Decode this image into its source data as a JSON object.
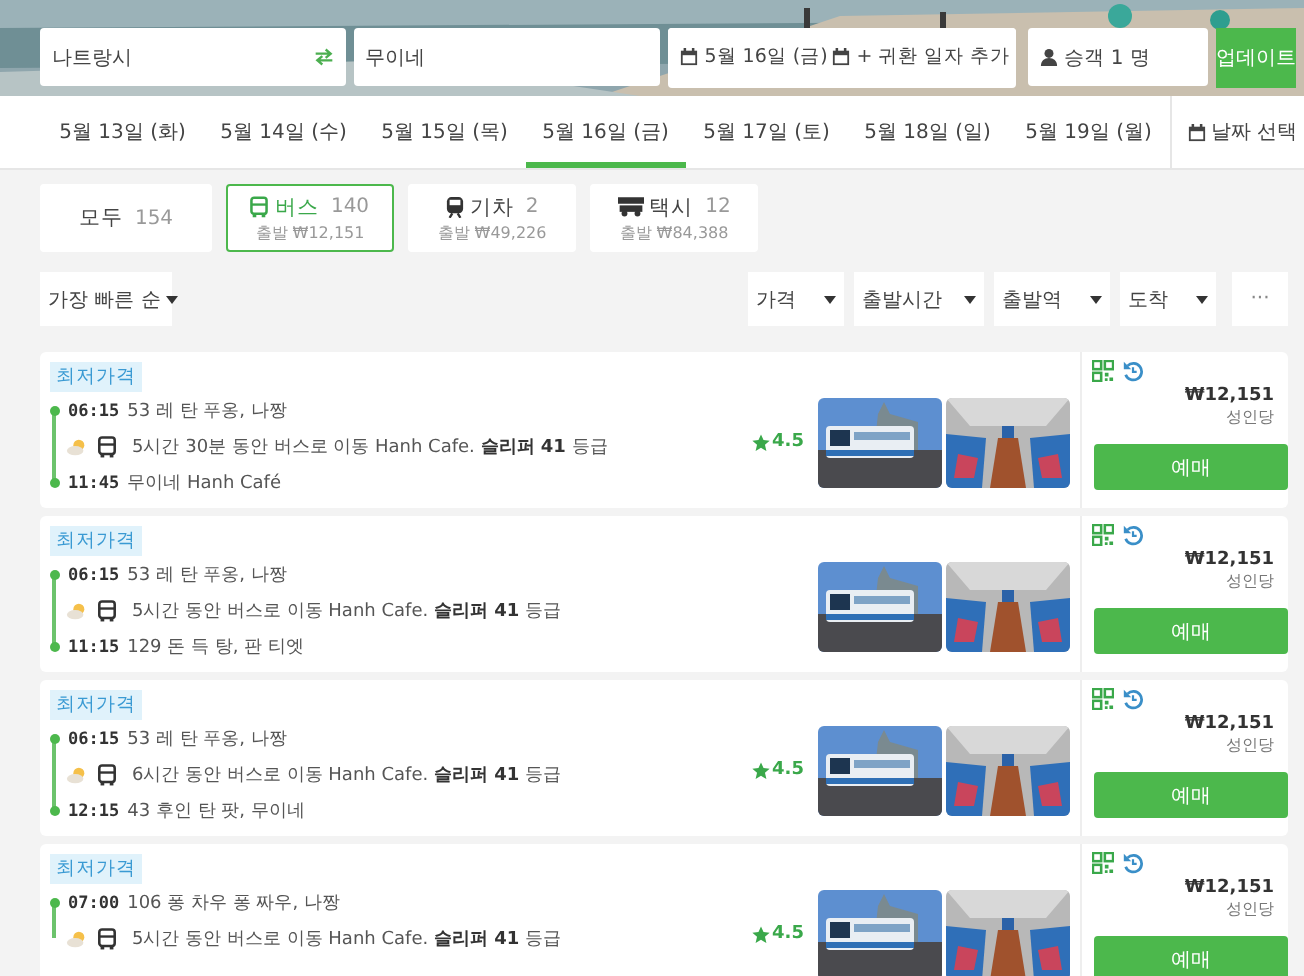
{
  "search": {
    "origin": "나트랑시",
    "destination": "무이네",
    "date": "5월 16일 (금)",
    "return_date": "+ 귀환 일자 추가",
    "passengers": "승객 1 명",
    "submit": "업데이트"
  },
  "date_tabs": [
    {
      "label": "5월 13일 (화)",
      "selected": false
    },
    {
      "label": "5월 14일 (수)",
      "selected": false
    },
    {
      "label": "5월 15일 (목)",
      "selected": false
    },
    {
      "label": "5월 16일 (금)",
      "selected": true
    },
    {
      "label": "5월 17일 (토)",
      "selected": false
    },
    {
      "label": "5월 18일 (일)",
      "selected": false
    },
    {
      "label": "5월 19일 (월)",
      "selected": false
    }
  ],
  "date_picker": "날짜 선택",
  "modes": [
    {
      "kind": "all",
      "label": "모두",
      "count": "154",
      "selected": false
    },
    {
      "kind": "bus",
      "label": "버스",
      "count": "140",
      "price": "출발 ₩12,151",
      "selected": true
    },
    {
      "kind": "train",
      "label": "기차",
      "count": "2",
      "price": "출발 ₩49,226",
      "selected": false
    },
    {
      "kind": "taxi",
      "label": "택시",
      "count": "12",
      "price": "출발 ₩84,388",
      "selected": false
    }
  ],
  "sort": "가장 빠른 순",
  "filters": [
    "가격",
    "출발시간",
    "출발역",
    "도착"
  ],
  "more": "···",
  "trips": [
    {
      "badge": "최저가격",
      "depart_time": "06:15",
      "depart_place": "53 레 탄 푸옹, 나짱",
      "details": "5시간 30분 동안 버스로 이동 Hanh Cafe. **슬리퍼 41** 등급",
      "arrive_time": "11:45",
      "arrive_place": "무이네 Hanh Café",
      "rating": "4.5",
      "price": "₩12,151",
      "price_note": "성인당",
      "button": "예매"
    },
    {
      "badge": "최저가격",
      "depart_time": "06:15",
      "depart_place": "53 레 탄 푸옹, 나짱",
      "details": "5시간 동안 버스로 이동 Hanh Cafe. **슬리퍼 41** 등급",
      "arrive_time": "11:15",
      "arrive_place": "129 돈 득 탕, 판 티엣",
      "price": "₩12,151",
      "price_note": "성인당",
      "button": "예매"
    },
    {
      "badge": "최저가격",
      "depart_time": "06:15",
      "depart_place": "53 레 탄 푸옹, 나짱",
      "details": "6시간 동안 버스로 이동 Hanh Cafe. **슬리퍼 41** 등급",
      "arrive_time": "12:15",
      "arrive_place": "43 후인 탄 팟, 무이네",
      "rating": "4.5",
      "price": "₩12,151",
      "price_note": "성인당",
      "button": "예매"
    },
    {
      "badge": "최저가격",
      "depart_time": "07:00",
      "depart_place": "106 퐁 차우 퐁 짜우, 나짱",
      "details": "5시간 동안 버스로 이동 Hanh Cafe. **슬리퍼 41** 등급",
      "rating": "4.5",
      "price": "₩12,151",
      "price_note": "성인당",
      "button": "예매"
    }
  ]
}
